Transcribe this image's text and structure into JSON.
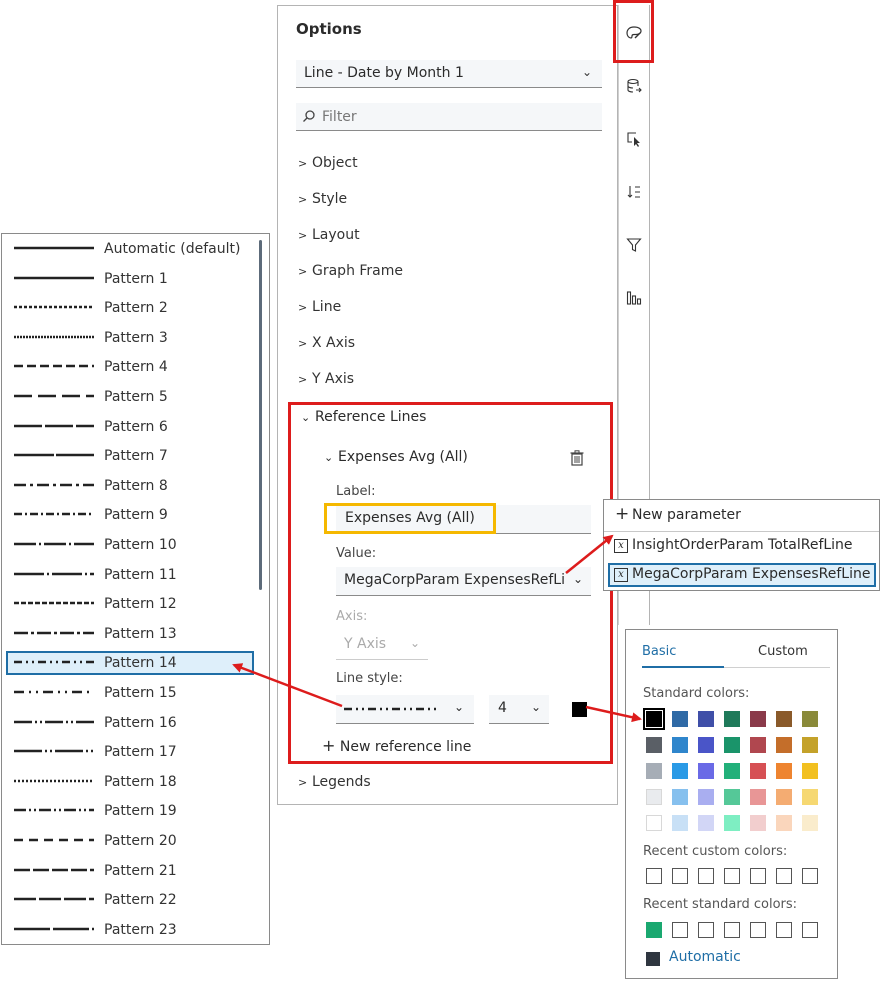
{
  "options": {
    "title": "Options",
    "graph_select": "Line - Date by Month 1",
    "filter_placeholder": "Filter",
    "sections": [
      "Object",
      "Style",
      "Layout",
      "Graph Frame",
      "Line",
      "X Axis",
      "Y Axis"
    ],
    "reference_lines": {
      "title": "Reference Lines",
      "item_title": "Expenses Avg (All)",
      "label_label": "Label:",
      "label_value": "Expenses Avg (All)",
      "value_label": "Value:",
      "value_value": "MegaCorpParam ExpensesRefLine",
      "axis_label": "Axis:",
      "axis_value": "Y Axis",
      "line_style_label": "Line style:",
      "line_width": "4",
      "line_color": "#000000",
      "new_reference_line": "New reference line"
    },
    "legends": "Legends"
  },
  "icons": [
    "palette-icon",
    "data-icon",
    "select-icon",
    "sort-icon",
    "filter-icon",
    "chart-bar-icon"
  ],
  "patterns": [
    {
      "label": "Automatic (default)",
      "dash": ""
    },
    {
      "label": "Pattern 1",
      "dash": ""
    },
    {
      "label": "Pattern 2",
      "dash": "3 2"
    },
    {
      "label": "Pattern 3",
      "dash": "2 1"
    },
    {
      "label": "Pattern 4",
      "dash": "9 4"
    },
    {
      "label": "Pattern 5",
      "dash": "18 6"
    },
    {
      "label": "Pattern 6",
      "dash": "28 3"
    },
    {
      "label": "Pattern 7",
      "dash": "40 2"
    },
    {
      "label": "Pattern 8",
      "dash": "12 4 3 4"
    },
    {
      "label": "Pattern 9",
      "dash": "8 3 2 3"
    },
    {
      "label": "Pattern 10",
      "dash": "22 3 2 3"
    },
    {
      "label": "Pattern 11",
      "dash": "30 3 2 3"
    },
    {
      "label": "Pattern 12",
      "dash": "5 2"
    },
    {
      "label": "Pattern 13",
      "dash": "14 3 3 3"
    },
    {
      "label": "Pattern 14",
      "dash": "8 4 2 4 2 4"
    },
    {
      "label": "Pattern 15",
      "dash": "10 5 2 5 2 5"
    },
    {
      "label": "Pattern 16",
      "dash": "18 3 2 3 2 3"
    },
    {
      "label": "Pattern 17",
      "dash": "28 3 2 3 2 3"
    },
    {
      "label": "Pattern 18",
      "dash": "2 2"
    },
    {
      "label": "Pattern 19",
      "dash": "12 3 2 3 2 3"
    },
    {
      "label": "Pattern 20",
      "dash": "9 6"
    },
    {
      "label": "Pattern 21",
      "dash": "16 3"
    },
    {
      "label": "Pattern 22",
      "dash": "22 3"
    },
    {
      "label": "Pattern 23",
      "dash": "36 3"
    }
  ],
  "selected_pattern": "Pattern 14",
  "param_popup": {
    "new_parameter": "New parameter",
    "items": [
      "InsightOrderParam TotalRefLine",
      "MegaCorpParam ExpensesRefLine"
    ],
    "selected": "MegaCorpParam ExpensesRefLine"
  },
  "color_popup": {
    "tabs": [
      "Basic",
      "Custom"
    ],
    "active_tab": "Basic",
    "standard_colors_label": "Standard colors:",
    "standard_colors": [
      [
        "#000000",
        "#2f6aa6",
        "#3f4fa8",
        "#1f7a5a",
        "#8a3a4a",
        "#8a5a2a",
        "#8a8a3a"
      ],
      [
        "#5a5f66",
        "#2f86cc",
        "#4a55c8",
        "#1a946a",
        "#b0474f",
        "#c46e2a",
        "#c4a22a"
      ],
      [
        "#a6adb6",
        "#2a9ae6",
        "#6a6ae6",
        "#22b07a",
        "#d65054",
        "#ee8430",
        "#f2c020"
      ],
      [
        "#e9ebee",
        "#86c0ee",
        "#a9aef0",
        "#55c898",
        "#e89696",
        "#f4ac72",
        "#f6d872"
      ],
      [
        "#ffffff",
        "#c8e0f6",
        "#d2d6f6",
        "#7eeec2",
        "#f2cece",
        "#fad6bc",
        "#faeccc"
      ]
    ],
    "recent_custom_label": "Recent custom colors:",
    "recent_standard_label": "Recent standard colors:",
    "recent_standard_first": "#1aa870",
    "automatic_label": "Automatic",
    "automatic_color": "#2f3640"
  }
}
